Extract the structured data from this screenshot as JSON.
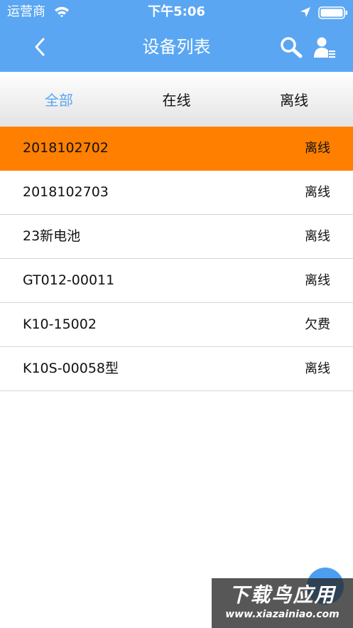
{
  "status_bar": {
    "carrier": "运营商",
    "time": "下午5:06"
  },
  "nav": {
    "title": "设备列表"
  },
  "tabs": [
    {
      "label": "全部",
      "active": true
    },
    {
      "label": "在线",
      "active": false
    },
    {
      "label": "离线",
      "active": false
    }
  ],
  "devices": [
    {
      "name": "2018102702",
      "status": "离线",
      "selected": true
    },
    {
      "name": "2018102703",
      "status": "离线",
      "selected": false
    },
    {
      "name": "23新电池",
      "status": "离线",
      "selected": false
    },
    {
      "name": "GT012-00011",
      "status": "离线",
      "selected": false
    },
    {
      "name": "K10-15002",
      "status": "欠费",
      "selected": false
    },
    {
      "name": "K10S-00058型",
      "status": "离线",
      "selected": false
    }
  ],
  "watermark": {
    "title": "下载鸟应用",
    "url": "www.xiazainiao.com"
  },
  "colors": {
    "header": "#5aa6f2",
    "selected_row": "#ff7f00",
    "active_tab": "#5aa6f2"
  },
  "icons": {
    "back": "chevron-left-icon",
    "search": "search-icon",
    "user_list": "user-list-icon",
    "wifi": "wifi-icon",
    "location": "location-arrow-icon",
    "battery": "battery-icon"
  }
}
